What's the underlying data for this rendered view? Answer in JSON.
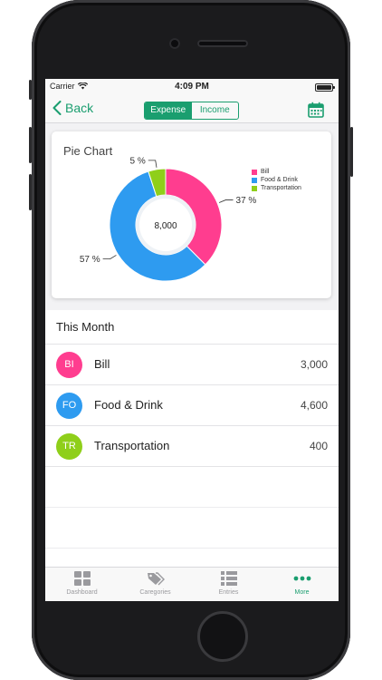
{
  "status_bar": {
    "carrier": "Carrier",
    "time": "4:09 PM"
  },
  "nav": {
    "back_label": "Back",
    "segments": [
      "Expense",
      "Income"
    ],
    "active_segment": "Expense",
    "calendar_icon": "calendar-icon"
  },
  "card": {
    "title": "Pie Chart"
  },
  "chart_data": {
    "type": "pie",
    "title": "Pie Chart",
    "center_label": "8,000",
    "slices": [
      {
        "label": "Bill",
        "value": 3000,
        "percent_label": "37 %",
        "color": "#ff3d8f"
      },
      {
        "label": "Food & Drink",
        "value": 4600,
        "percent_label": "57 %",
        "color": "#2e9bf0"
      },
      {
        "label": "Transportation",
        "value": 400,
        "percent_label": "5 %",
        "color": "#8fcf1a"
      }
    ],
    "legend": [
      "Bill",
      "Food & Drink",
      "Transportation"
    ],
    "legend_position": "top-right"
  },
  "section": {
    "title": "This Month"
  },
  "categories": [
    {
      "initials": "BI",
      "name": "Bill",
      "amount": "3,000",
      "color": "#ff3d8f"
    },
    {
      "initials": "FO",
      "name": "Food & Drink",
      "amount": "4,600",
      "color": "#2e9bf0"
    },
    {
      "initials": "TR",
      "name": "Transportation",
      "amount": "400",
      "color": "#8fcf1a"
    }
  ],
  "tabbar": {
    "tabs": [
      {
        "label": "Dashboard",
        "icon": "dashboard-icon"
      },
      {
        "label": "Caregories",
        "icon": "tag-icon"
      },
      {
        "label": "Entries",
        "icon": "list-icon"
      },
      {
        "label": "More",
        "icon": "more-icon"
      }
    ],
    "active": "More"
  },
  "colors": {
    "accent": "#1a9e6f"
  }
}
